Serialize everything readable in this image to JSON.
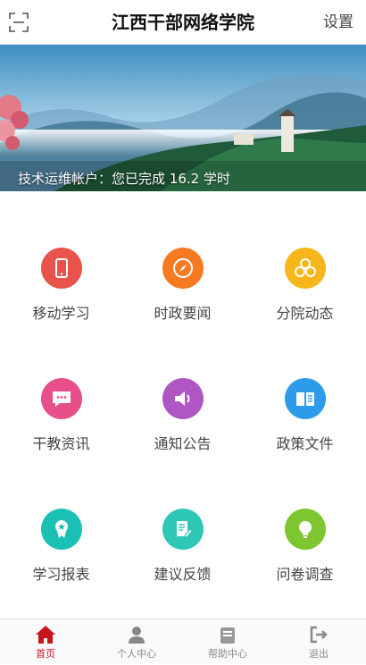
{
  "header": {
    "title": "江西干部网络学院",
    "settings_label": "设置",
    "scan_icon": "scan-icon"
  },
  "banner": {
    "caption": "技术运维帐户：您已完成 16.2 学时"
  },
  "menu": [
    {
      "label": "移动学习",
      "icon": "mobile-phone-icon",
      "color": "#e8534b"
    },
    {
      "label": "时政要闻",
      "icon": "compass-icon",
      "color": "#f57a22"
    },
    {
      "label": "分院动态",
      "icon": "hexagons-icon",
      "color": "#f7b61a"
    },
    {
      "label": "干教资讯",
      "icon": "chat-bubble-icon",
      "color": "#e84e8a"
    },
    {
      "label": "通知公告",
      "icon": "speaker-icon",
      "color": "#b055c4"
    },
    {
      "label": "政策文件",
      "icon": "book-icon",
      "color": "#2d9bea"
    },
    {
      "label": "学习报表",
      "icon": "award-badge-icon",
      "color": "#1bc0b5"
    },
    {
      "label": "建议反馈",
      "icon": "document-edit-icon",
      "color": "#2ec7b6"
    },
    {
      "label": "问卷调查",
      "icon": "lightbulb-icon",
      "color": "#7dc630"
    }
  ],
  "tabbar": [
    {
      "label": "首页",
      "icon": "home-icon",
      "active": true,
      "color": "#c9141c"
    },
    {
      "label": "个人中心",
      "icon": "user-icon",
      "active": false
    },
    {
      "label": "帮助中心",
      "icon": "help-icon",
      "active": false
    },
    {
      "label": "退出",
      "icon": "exit-icon",
      "active": false
    }
  ]
}
